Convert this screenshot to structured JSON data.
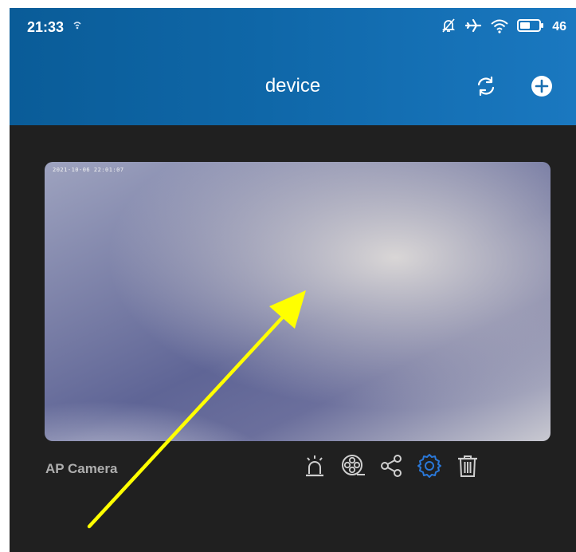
{
  "status_bar": {
    "time": "21:33",
    "battery_level": "46",
    "icons": [
      "wifi-call-icon",
      "bell-off-icon",
      "airplane-icon",
      "wifi-icon",
      "battery-icon"
    ]
  },
  "app_bar": {
    "title": "device",
    "refresh_icon": "refresh-icon",
    "add_icon": "add-circle-icon",
    "color": "#0f67a8"
  },
  "device": {
    "name": "AP Camera",
    "preview_timestamp": "2021-10-06 22:01:07",
    "actions": [
      {
        "name": "alarm",
        "icon": "alarm-icon",
        "color": "#cfcfcf"
      },
      {
        "name": "playback",
        "icon": "film-reel-icon",
        "color": "#cfcfcf"
      },
      {
        "name": "share",
        "icon": "share-icon",
        "color": "#cfcfcf"
      },
      {
        "name": "settings",
        "icon": "settings-icon",
        "color": "#2a78d8"
      },
      {
        "name": "delete",
        "icon": "trash-icon",
        "color": "#cfcfcf"
      }
    ]
  },
  "annotation": {
    "arrow_color": "#ffff00"
  }
}
